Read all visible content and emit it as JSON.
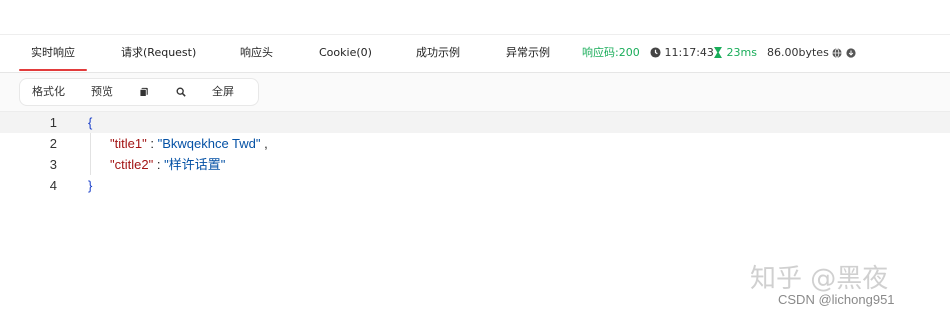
{
  "tabs": [
    {
      "label": "实时响应",
      "active": true
    },
    {
      "label": "请求(Request)",
      "active": false
    },
    {
      "label": "响应头",
      "active": false
    },
    {
      "label": "Cookie(0)",
      "active": false
    },
    {
      "label": "成功示例",
      "active": false
    },
    {
      "label": "异常示例",
      "active": false
    }
  ],
  "status": {
    "code_text": "响应码:200",
    "time_text": "11:17:43",
    "duration_text": "23ms",
    "size_text": "86.00bytes",
    "accent_color": "#1aad5a"
  },
  "toolbar": {
    "format_label": "格式化",
    "preview_label": "预览",
    "copy_icon": "copy-icon",
    "search_icon": "search-icon",
    "fullscreen_label": "全屏"
  },
  "editor": {
    "lines": [
      {
        "num": "1",
        "open": "{"
      },
      {
        "num": "2",
        "key": "\"title1\"",
        "colon": ":",
        "value": "\"Bkwqekhce Twd\"",
        "comma": ","
      },
      {
        "num": "3",
        "key": "\"ctitle2\"",
        "colon": ":",
        "value": "\"样许话置\""
      },
      {
        "num": "4",
        "close": "}"
      }
    ]
  },
  "watermark": {
    "zhihu_text": "知乎 @黑夜",
    "csdn_text": "CSDN @lichong951"
  }
}
